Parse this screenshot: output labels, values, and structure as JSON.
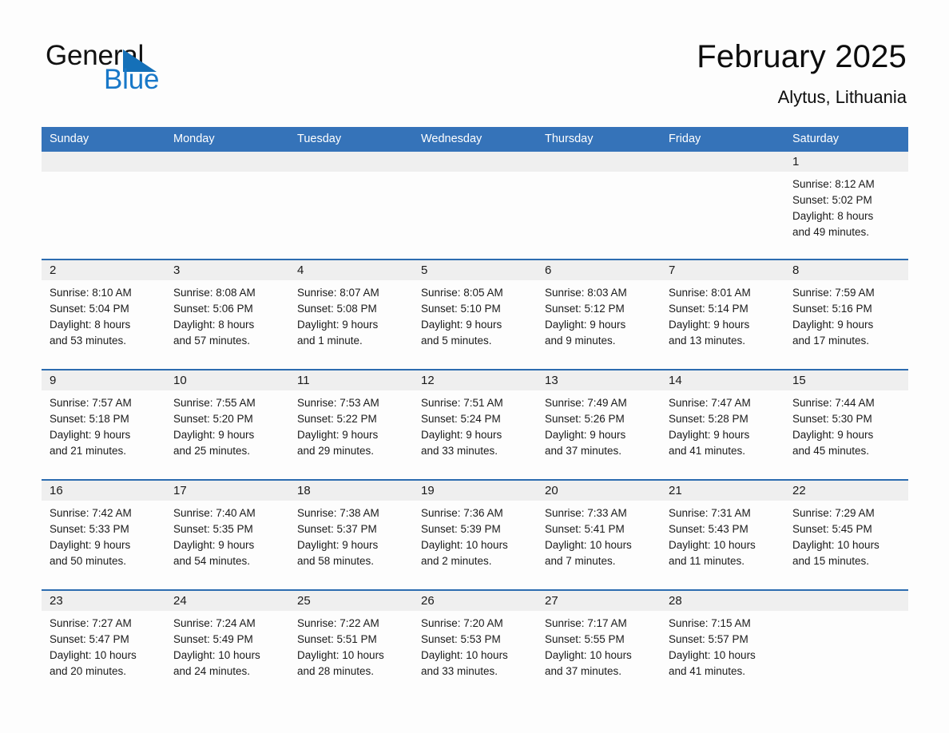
{
  "brand": {
    "name_part1": "General",
    "name_part2": "Blue",
    "triangle_color": "#1570b8",
    "blue_color": "#1878c8"
  },
  "header": {
    "month_title": "February 2025",
    "location": "Alytus, Lithuania"
  },
  "theme": {
    "header_blue": "#3573b9",
    "row_divider_blue": "#2c6cb0",
    "daynum_band": "#efefef",
    "page_background": "#fdfdfd"
  },
  "weekday_headers": [
    "Sunday",
    "Monday",
    "Tuesday",
    "Wednesday",
    "Thursday",
    "Friday",
    "Saturday"
  ],
  "weeks": [
    [
      {
        "day": "",
        "sunrise": "",
        "sunset": "",
        "daylight1": "",
        "daylight2": ""
      },
      {
        "day": "",
        "sunrise": "",
        "sunset": "",
        "daylight1": "",
        "daylight2": ""
      },
      {
        "day": "",
        "sunrise": "",
        "sunset": "",
        "daylight1": "",
        "daylight2": ""
      },
      {
        "day": "",
        "sunrise": "",
        "sunset": "",
        "daylight1": "",
        "daylight2": ""
      },
      {
        "day": "",
        "sunrise": "",
        "sunset": "",
        "daylight1": "",
        "daylight2": ""
      },
      {
        "day": "",
        "sunrise": "",
        "sunset": "",
        "daylight1": "",
        "daylight2": ""
      },
      {
        "day": "1",
        "sunrise": "Sunrise: 8:12 AM",
        "sunset": "Sunset: 5:02 PM",
        "daylight1": "Daylight: 8 hours",
        "daylight2": "and 49 minutes."
      }
    ],
    [
      {
        "day": "2",
        "sunrise": "Sunrise: 8:10 AM",
        "sunset": "Sunset: 5:04 PM",
        "daylight1": "Daylight: 8 hours",
        "daylight2": "and 53 minutes."
      },
      {
        "day": "3",
        "sunrise": "Sunrise: 8:08 AM",
        "sunset": "Sunset: 5:06 PM",
        "daylight1": "Daylight: 8 hours",
        "daylight2": "and 57 minutes."
      },
      {
        "day": "4",
        "sunrise": "Sunrise: 8:07 AM",
        "sunset": "Sunset: 5:08 PM",
        "daylight1": "Daylight: 9 hours",
        "daylight2": "and 1 minute."
      },
      {
        "day": "5",
        "sunrise": "Sunrise: 8:05 AM",
        "sunset": "Sunset: 5:10 PM",
        "daylight1": "Daylight: 9 hours",
        "daylight2": "and 5 minutes."
      },
      {
        "day": "6",
        "sunrise": "Sunrise: 8:03 AM",
        "sunset": "Sunset: 5:12 PM",
        "daylight1": "Daylight: 9 hours",
        "daylight2": "and 9 minutes."
      },
      {
        "day": "7",
        "sunrise": "Sunrise: 8:01 AM",
        "sunset": "Sunset: 5:14 PM",
        "daylight1": "Daylight: 9 hours",
        "daylight2": "and 13 minutes."
      },
      {
        "day": "8",
        "sunrise": "Sunrise: 7:59 AM",
        "sunset": "Sunset: 5:16 PM",
        "daylight1": "Daylight: 9 hours",
        "daylight2": "and 17 minutes."
      }
    ],
    [
      {
        "day": "9",
        "sunrise": "Sunrise: 7:57 AM",
        "sunset": "Sunset: 5:18 PM",
        "daylight1": "Daylight: 9 hours",
        "daylight2": "and 21 minutes."
      },
      {
        "day": "10",
        "sunrise": "Sunrise: 7:55 AM",
        "sunset": "Sunset: 5:20 PM",
        "daylight1": "Daylight: 9 hours",
        "daylight2": "and 25 minutes."
      },
      {
        "day": "11",
        "sunrise": "Sunrise: 7:53 AM",
        "sunset": "Sunset: 5:22 PM",
        "daylight1": "Daylight: 9 hours",
        "daylight2": "and 29 minutes."
      },
      {
        "day": "12",
        "sunrise": "Sunrise: 7:51 AM",
        "sunset": "Sunset: 5:24 PM",
        "daylight1": "Daylight: 9 hours",
        "daylight2": "and 33 minutes."
      },
      {
        "day": "13",
        "sunrise": "Sunrise: 7:49 AM",
        "sunset": "Sunset: 5:26 PM",
        "daylight1": "Daylight: 9 hours",
        "daylight2": "and 37 minutes."
      },
      {
        "day": "14",
        "sunrise": "Sunrise: 7:47 AM",
        "sunset": "Sunset: 5:28 PM",
        "daylight1": "Daylight: 9 hours",
        "daylight2": "and 41 minutes."
      },
      {
        "day": "15",
        "sunrise": "Sunrise: 7:44 AM",
        "sunset": "Sunset: 5:30 PM",
        "daylight1": "Daylight: 9 hours",
        "daylight2": "and 45 minutes."
      }
    ],
    [
      {
        "day": "16",
        "sunrise": "Sunrise: 7:42 AM",
        "sunset": "Sunset: 5:33 PM",
        "daylight1": "Daylight: 9 hours",
        "daylight2": "and 50 minutes."
      },
      {
        "day": "17",
        "sunrise": "Sunrise: 7:40 AM",
        "sunset": "Sunset: 5:35 PM",
        "daylight1": "Daylight: 9 hours",
        "daylight2": "and 54 minutes."
      },
      {
        "day": "18",
        "sunrise": "Sunrise: 7:38 AM",
        "sunset": "Sunset: 5:37 PM",
        "daylight1": "Daylight: 9 hours",
        "daylight2": "and 58 minutes."
      },
      {
        "day": "19",
        "sunrise": "Sunrise: 7:36 AM",
        "sunset": "Sunset: 5:39 PM",
        "daylight1": "Daylight: 10 hours",
        "daylight2": "and 2 minutes."
      },
      {
        "day": "20",
        "sunrise": "Sunrise: 7:33 AM",
        "sunset": "Sunset: 5:41 PM",
        "daylight1": "Daylight: 10 hours",
        "daylight2": "and 7 minutes."
      },
      {
        "day": "21",
        "sunrise": "Sunrise: 7:31 AM",
        "sunset": "Sunset: 5:43 PM",
        "daylight1": "Daylight: 10 hours",
        "daylight2": "and 11 minutes."
      },
      {
        "day": "22",
        "sunrise": "Sunrise: 7:29 AM",
        "sunset": "Sunset: 5:45 PM",
        "daylight1": "Daylight: 10 hours",
        "daylight2": "and 15 minutes."
      }
    ],
    [
      {
        "day": "23",
        "sunrise": "Sunrise: 7:27 AM",
        "sunset": "Sunset: 5:47 PM",
        "daylight1": "Daylight: 10 hours",
        "daylight2": "and 20 minutes."
      },
      {
        "day": "24",
        "sunrise": "Sunrise: 7:24 AM",
        "sunset": "Sunset: 5:49 PM",
        "daylight1": "Daylight: 10 hours",
        "daylight2": "and 24 minutes."
      },
      {
        "day": "25",
        "sunrise": "Sunrise: 7:22 AM",
        "sunset": "Sunset: 5:51 PM",
        "daylight1": "Daylight: 10 hours",
        "daylight2": "and 28 minutes."
      },
      {
        "day": "26",
        "sunrise": "Sunrise: 7:20 AM",
        "sunset": "Sunset: 5:53 PM",
        "daylight1": "Daylight: 10 hours",
        "daylight2": "and 33 minutes."
      },
      {
        "day": "27",
        "sunrise": "Sunrise: 7:17 AM",
        "sunset": "Sunset: 5:55 PM",
        "daylight1": "Daylight: 10 hours",
        "daylight2": "and 37 minutes."
      },
      {
        "day": "28",
        "sunrise": "Sunrise: 7:15 AM",
        "sunset": "Sunset: 5:57 PM",
        "daylight1": "Daylight: 10 hours",
        "daylight2": "and 41 minutes."
      },
      {
        "day": "",
        "sunrise": "",
        "sunset": "",
        "daylight1": "",
        "daylight2": ""
      }
    ]
  ]
}
